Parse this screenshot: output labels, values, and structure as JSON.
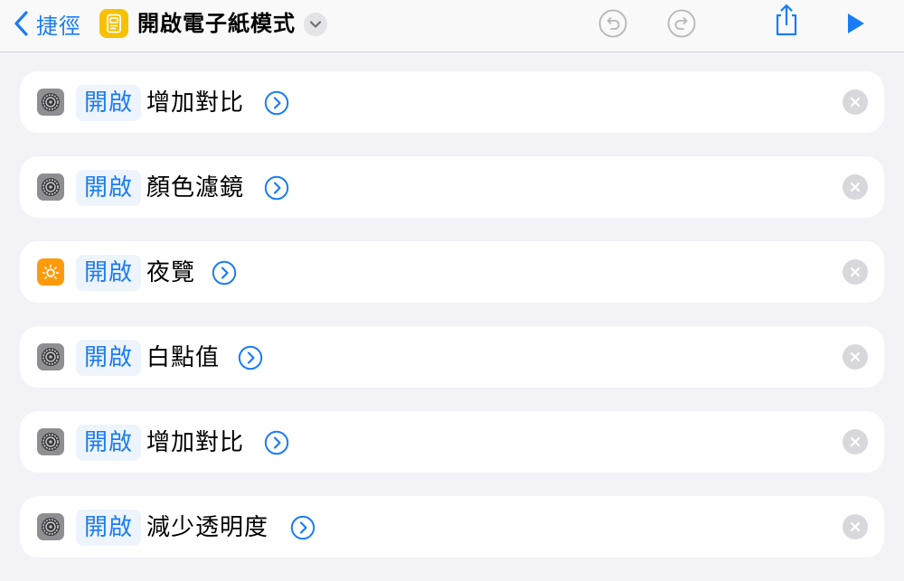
{
  "navbar": {
    "back_label": "捷徑",
    "title": "開啟電子紙模式",
    "icons": {
      "back": "chevron-left-icon",
      "app": "shortcut-app-icon",
      "title_menu": "chevron-down-icon",
      "undo": "undo-icon",
      "redo": "redo-icon",
      "share": "share-icon",
      "run": "play-icon"
    }
  },
  "actions": [
    {
      "param": "開啟",
      "label": "增加對比",
      "icon": "settings-gear-icon"
    },
    {
      "param": "開啟",
      "label": "顏色濾鏡",
      "icon": "settings-gear-icon"
    },
    {
      "param": "開啟",
      "label": "夜覽",
      "icon": "sun-icon"
    },
    {
      "param": "開啟",
      "label": "白點值",
      "icon": "settings-gear-icon"
    },
    {
      "param": "開啟",
      "label": "增加對比",
      "icon": "settings-gear-icon"
    },
    {
      "param": "開啟",
      "label": "減少透明度",
      "icon": "settings-gear-icon"
    }
  ],
  "colors": {
    "accent": "#1a7cf5",
    "background": "#f2f2f7",
    "app_icon": "#f6c100",
    "settings_icon": "#8e8e93",
    "night_shift_icon": "#ff9a0a"
  }
}
